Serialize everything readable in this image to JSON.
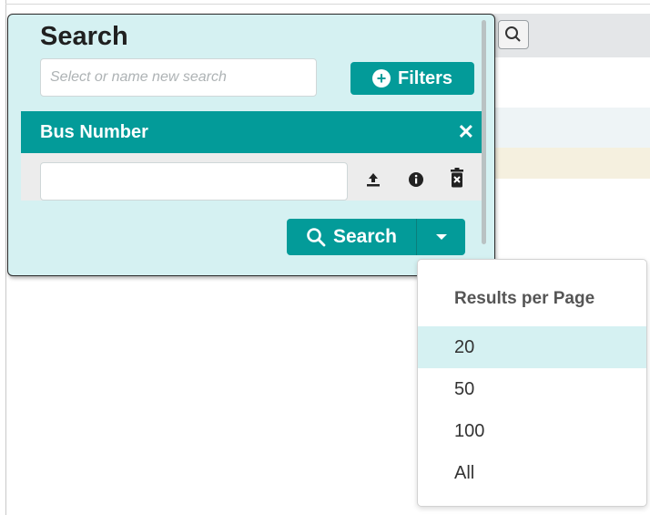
{
  "panel": {
    "title": "Search",
    "search_name_placeholder": "Select or name new search",
    "filters_label": "Filters"
  },
  "filter": {
    "title": "Bus Number",
    "value": ""
  },
  "search_button": {
    "label": "Search"
  },
  "dropdown": {
    "header": "Results per Page",
    "items": [
      "20",
      "50",
      "100",
      "All"
    ],
    "selected": "20"
  },
  "colors": {
    "accent": "#039b99",
    "panel_bg": "#d5f1f2",
    "selected_bg": "#d5f1f2"
  },
  "icons": {
    "plus": "plus-circle-icon",
    "close": "close-icon",
    "upload": "upload-icon",
    "info": "info-icon",
    "trash": "trash-icon",
    "search": "search-icon",
    "caret": "caret-down-icon"
  }
}
